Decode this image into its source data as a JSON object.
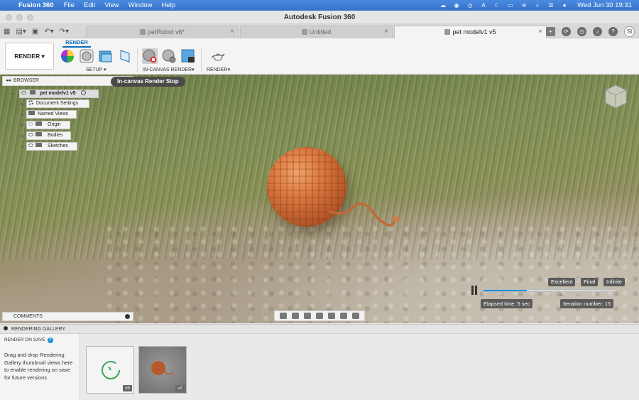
{
  "menubar": {
    "app_name": "Fusion 360",
    "items": [
      "File",
      "Edit",
      "View",
      "Window",
      "Help"
    ],
    "clock": "Wed Jun 30  19:31"
  },
  "window": {
    "title": "Autodesk Fusion 360"
  },
  "tabs": [
    {
      "label": "petRobot v6*",
      "active": false
    },
    {
      "label": "Untitled",
      "active": false
    },
    {
      "label": "pet modelv1 v5",
      "active": true
    }
  ],
  "account": {
    "initials": "SI"
  },
  "toolbar": {
    "workspace": "RENDER",
    "ribbon_tab": "RENDER",
    "groups": {
      "setup": "SETUP",
      "in_canvas": "IN-CANVAS RENDER",
      "render": "RENDER"
    }
  },
  "browser": {
    "header": "BROWSER",
    "root": "pet modelv1 v5",
    "items": [
      "Document Settings",
      "Named Views",
      "Origin",
      "Bodies",
      "Sketches"
    ]
  },
  "tooltip": "In-canvas Render Stop",
  "render_progress": {
    "quality_labels": [
      "Excellent",
      "Final",
      "Infinite"
    ],
    "elapsed": "Elapsed time: 5 sec",
    "iteration": "Iteration number: 15",
    "progress_fraction": 0.33
  },
  "comments": {
    "label": "COMMENTS"
  },
  "gallery": {
    "header": "RENDERING GALLERY",
    "render_on_save": "RENDER ON SAVE",
    "description": "Drag and drop Rendering Gallery thumbnail views here to enable rendering on save for future versions",
    "thumbs": [
      {
        "version": "v5"
      },
      {
        "version": "v2"
      }
    ]
  },
  "colors": {
    "accent": "#1e90d8",
    "menubar": "#3672c8"
  }
}
